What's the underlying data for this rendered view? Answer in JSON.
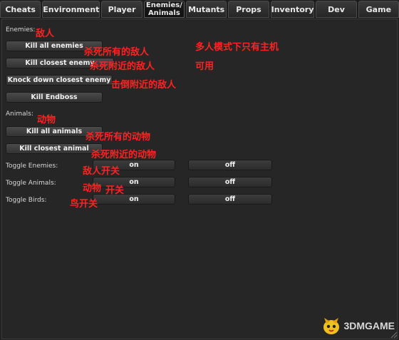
{
  "tabs": [
    {
      "label": "Cheats"
    },
    {
      "label": "Environment"
    },
    {
      "label": "Player"
    },
    {
      "label": "Enemies/\nAnimals"
    },
    {
      "label": "Mutants"
    },
    {
      "label": "Props"
    },
    {
      "label": "Inventory"
    },
    {
      "label": "Dev"
    },
    {
      "label": "Game"
    }
  ],
  "enemies": {
    "section_label": "Enemies:",
    "kill_all": "Kill all enemies",
    "kill_closest": "Kill closest enemy",
    "knock_down_closest": "Knock down closest enemy",
    "kill_endboss": "Kill Endboss"
  },
  "animals": {
    "section_label": "Animals:",
    "kill_all": "Kill all animals",
    "kill_closest": "Kill closest animal"
  },
  "toggles": [
    {
      "label": "Toggle Enemies:",
      "on": "on",
      "off": "off"
    },
    {
      "label": "Toggle Animals:",
      "on": "on",
      "off": "off"
    },
    {
      "label": "Toggle Birds:",
      "on": "on",
      "off": "off"
    }
  ],
  "annotations": {
    "enemies": "敌人",
    "kill_all_enemies": "杀死所有的敌人",
    "kill_closest_enemy": "杀死附近的敌人",
    "knock_down": "击倒附近的敌人",
    "multiplayer_line1": "多人模式下只有主机",
    "multiplayer_line2": "可用",
    "animals": "动物",
    "kill_all_animals": "杀死所有的动物",
    "kill_closest_animal": "杀死附近的动物",
    "toggle_enemies": "敌人开关",
    "toggle_animals_a": "动物",
    "toggle_animals_b": "开关",
    "toggle_birds": "鸟开关"
  },
  "watermark": {
    "text": "3DMGAME"
  },
  "colors": {
    "annotation": "#ff2222",
    "background": "#232323"
  }
}
